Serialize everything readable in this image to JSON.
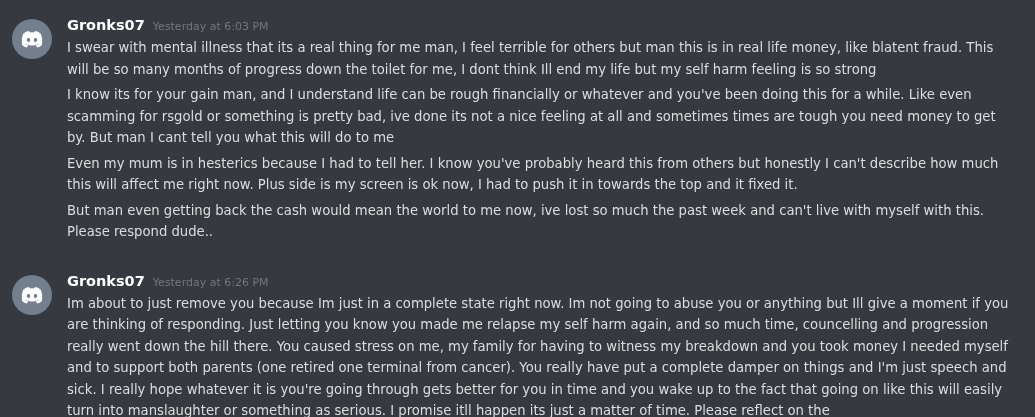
{
  "messages": [
    {
      "author": "Gronks07",
      "timestamp": "Yesterday at 6:03 PM",
      "paragraphs": [
        "I swear with mental illness that its a real thing for me man, I feel terrible for others but man this is in real life money, like blatent fraud. This will be so many months of progress down the toilet for me, I dont think Ill end my life but my self harm feeling is so strong",
        "I know its for your gain man, and I understand life can be rough financially or whatever and you've been doing this for a while. Like even scamming for rsgold or something is pretty bad, ive done its not a nice feeling at all and sometimes times are tough you need money to get by. But man I cant tell you what this will do to me",
        "Even my mum is in hesterics because I had to tell her. I know you've probably heard this from others but honestly I can't describe how much this will affect me right now. Plus side is my screen is ok now, I had to push it in towards the top and it fixed it.",
        "But man even getting back the cash would mean the world to me now, ive lost so much the past week and can't live with myself with this. Please respond dude.."
      ]
    },
    {
      "author": "Gronks07",
      "timestamp": "Yesterday at 6:26 PM",
      "paragraphs": [
        "Im about to just remove you because Im just in a complete state right now. Im not going to abuse you or anything but Ill give a moment if you are thinking of responding. Just letting you know you made me relapse my self harm again, and so much time, councelling and progression really went down the hill there. You caused stress on me, my family for having to witness my breakdown and you took money I needed myself and to support both parents (one retired one terminal from cancer). You really have put a complete damper on things and I'm just speech and sick. I really hope whatever it is you're going through gets better for you in time and you wake up to the fact that going on like this will easily turn into manslaughter or something as serious. I promise itll happen its just a matter of time. Please reflect on the"
      ]
    }
  ]
}
